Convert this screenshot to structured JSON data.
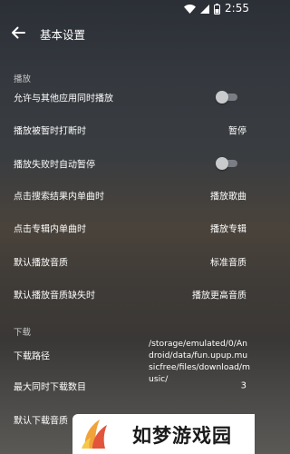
{
  "status_bar": {
    "time": "2:55",
    "icons": [
      "wifi-icon",
      "signal-icon",
      "battery-icon"
    ]
  },
  "app_bar": {
    "title": "基本设置",
    "back_icon": "arrow-left-icon"
  },
  "sections": {
    "playback": {
      "title": "播放",
      "items": [
        {
          "label": "允许与其他应用同时播放",
          "type": "toggle",
          "on": false
        },
        {
          "label": "播放被暂时打断时",
          "type": "value",
          "value": "暂停"
        },
        {
          "label": "播放失败时自动暂停",
          "type": "toggle",
          "on": false
        },
        {
          "label": "点击搜索结果内单曲时",
          "type": "value",
          "value": "播放歌曲"
        },
        {
          "label": "点击专辑内单曲时",
          "type": "value",
          "value": "播放专辑"
        },
        {
          "label": "默认播放音质",
          "type": "value",
          "value": "标准音质"
        },
        {
          "label": "默认播放音质缺失时",
          "type": "value",
          "value": "播放更高音质"
        }
      ]
    },
    "download": {
      "title": "下载",
      "items": [
        {
          "label": "下载路径",
          "type": "value",
          "value": "/storage/emulated/0/Android/data/fun.upup.musicfree/files/download/music/"
        },
        {
          "label": "最大同时下载数目",
          "type": "value",
          "value": "3"
        },
        {
          "label": "默认下载音质",
          "type": "value",
          "value": ""
        }
      ]
    }
  },
  "watermark": {
    "text": "如梦游戏园"
  },
  "colors": {
    "toggle_track": "#7a7e84",
    "toggle_thumb": "#c9cacc"
  }
}
